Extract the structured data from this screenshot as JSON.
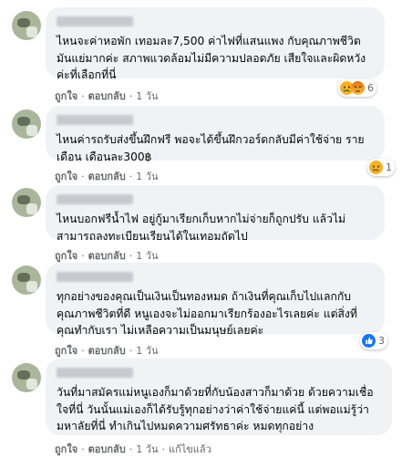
{
  "comments": [
    {
      "text": "ไหนจะค่าหอพัก เทอมละ7,500 ค่าไฟที่แสนแพง กับคุณภาพชีวิตมันแย่มากค่ะ สภาพแวดล้อมไม่มีความปลอดภัย เสียใจและผิดหวังค่ะที่เลือกที่นี่",
      "like_label": "ถูกใจ",
      "reply_label": "ตอบกลับ",
      "time": "1 วัน",
      "reaction_count": "6",
      "reactions": [
        "sad-icon",
        "angry-icon"
      ]
    },
    {
      "text": "ไหนค่ารถรับส่งขึ้นฝึกฟรี พอจะได้ขึ้นฝึกวอร์ดกลับมีค่าใช้จ่าย รายเดือน เดือนละ300฿",
      "like_label": "ถูกใจ",
      "reply_label": "ตอบกลับ",
      "time": "1 วัน",
      "reaction_count": "1",
      "reactions": [
        "sad-icon"
      ]
    },
    {
      "text": "ไหนบอกฟรีน้ำไฟ อยู่กู้มาเรียกเก็บหากไม่จ่ายก็ถูกปรับ แล้วไม่สามารถลงทะเบียนเรียนได้ในเทอมถัดไป",
      "like_label": "ถูกใจ",
      "reply_label": "ตอบกลับ",
      "time": "1 วัน"
    },
    {
      "text": "ทุกอย่างของคุณเป็นเงินเป็นทองหมด ถ้าเงินที่คุณเก็บไปแลกกับคุณภาพชีวิตที่ดี หนูเองจะไม่ออกมาเรียกร้องอะไรเลยค่ะ แต่สิ่งที่คุณทำกับเรา ไม่เหลือความเป็นมนุษย์เลยค่ะ",
      "like_label": "ถูกใจ",
      "reply_label": "ตอบกลับ",
      "time": "1 วัน",
      "reaction_count": "3",
      "reactions": [
        "like-icon"
      ]
    },
    {
      "text": "วันที่มาสมัครแม่หนูเองก็มาด้วยที่กับน้องสาวก็มาด้วย ด้วยความเชื่อใจที่นี่ วันนั้นแม่เองก็ได้รับรู้ทุกอย่างว่าค่าใช้จ่ายแค่นี้ แต่พอแม่รู้ว่ามหาลัยที่นี่ ทำเกินไปหมดความศรัทธาค่ะ หมดทุกอย่าง",
      "like_label": "ถูกใจ",
      "reply_label": "ตอบกลับ",
      "time": "1 วัน",
      "edited_label": "แก้ไขแล้ว"
    }
  ],
  "colors": {
    "bubble": "#f0f2f5",
    "text": "#050505",
    "meta": "#65676b",
    "like_blue": "#1877f2",
    "sad_yellow": "#f7b125"
  }
}
